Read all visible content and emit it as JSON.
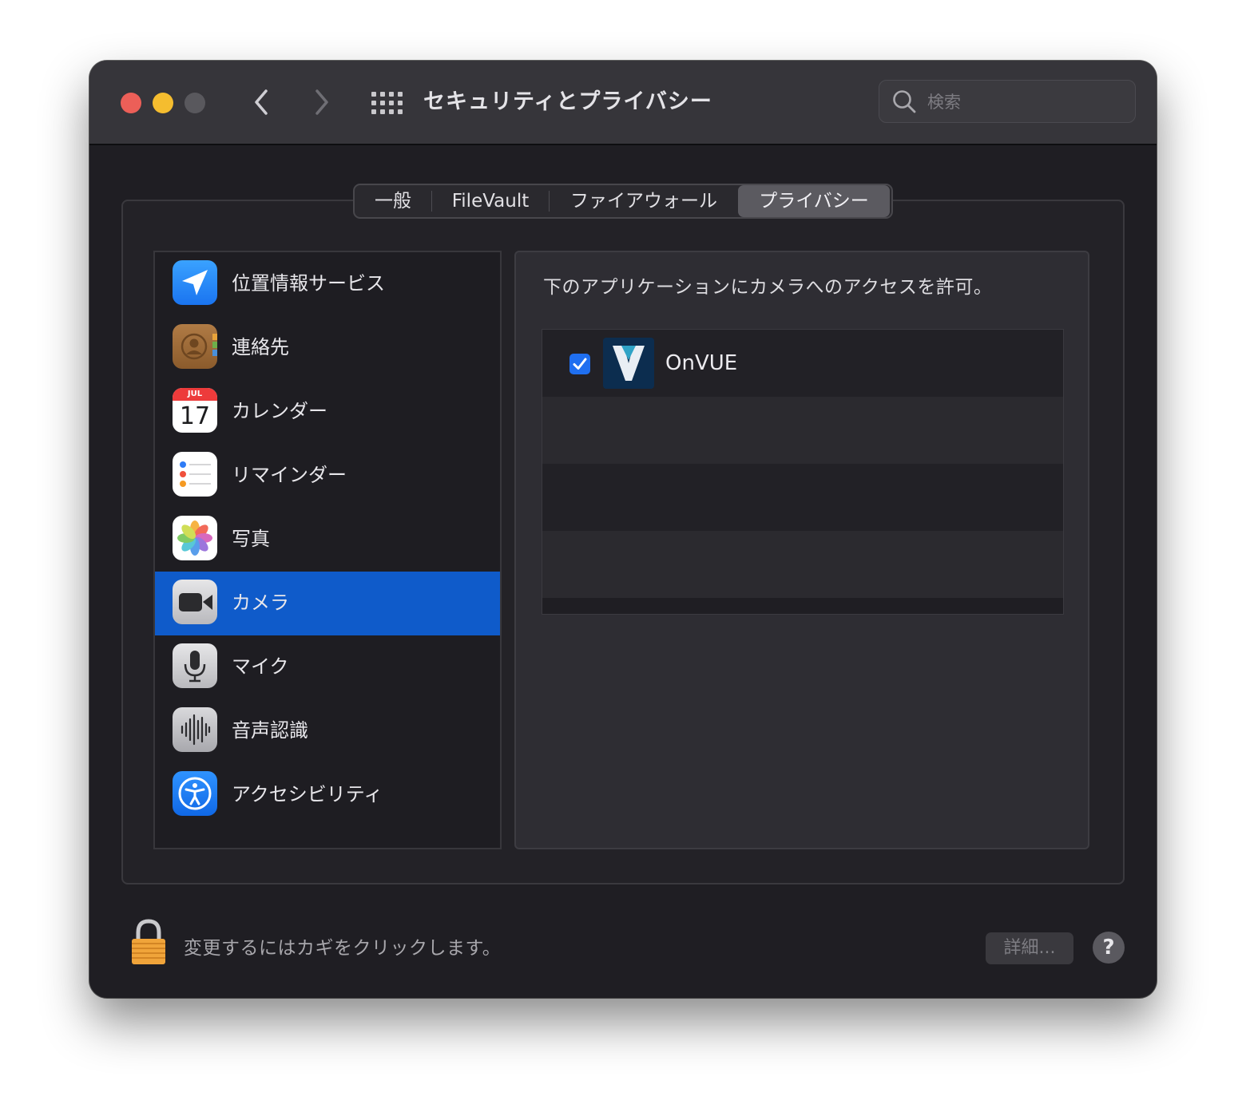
{
  "window": {
    "title": "セキュリティとプライバシー",
    "search_placeholder": "検索"
  },
  "tabs": [
    {
      "label": "一般",
      "active": false
    },
    {
      "label": "FileVault",
      "active": false
    },
    {
      "label": "ファイアウォール",
      "active": false
    },
    {
      "label": "プライバシー",
      "active": true
    }
  ],
  "sidebar": {
    "items": [
      {
        "label": "位置情報サービス",
        "icon": "location-arrow-icon"
      },
      {
        "label": "連絡先",
        "icon": "contacts-icon"
      },
      {
        "label": "カレンダー",
        "icon": "calendar-icon",
        "month": "JUL",
        "day": "17"
      },
      {
        "label": "リマインダー",
        "icon": "reminders-icon"
      },
      {
        "label": "写真",
        "icon": "photos-icon"
      },
      {
        "label": "カメラ",
        "icon": "camera-icon",
        "selected": true
      },
      {
        "label": "マイク",
        "icon": "microphone-icon"
      },
      {
        "label": "音声認識",
        "icon": "speech-recognition-icon"
      },
      {
        "label": "アクセシビリティ",
        "icon": "accessibility-icon"
      }
    ]
  },
  "content": {
    "description": "下のアプリケーションにカメラへのアクセスを許可。",
    "apps": [
      {
        "name": "OnVUE",
        "checked": true,
        "icon": "onvue-icon"
      }
    ]
  },
  "footer": {
    "lock_text": "変更するにはカギをクリックします。",
    "advanced_label": "詳細...",
    "help_label": "?"
  },
  "colors": {
    "selection": "#0f5bca",
    "checkbox": "#1f6ff0",
    "close": "#ec5f58",
    "minimize": "#f5bd2f"
  }
}
